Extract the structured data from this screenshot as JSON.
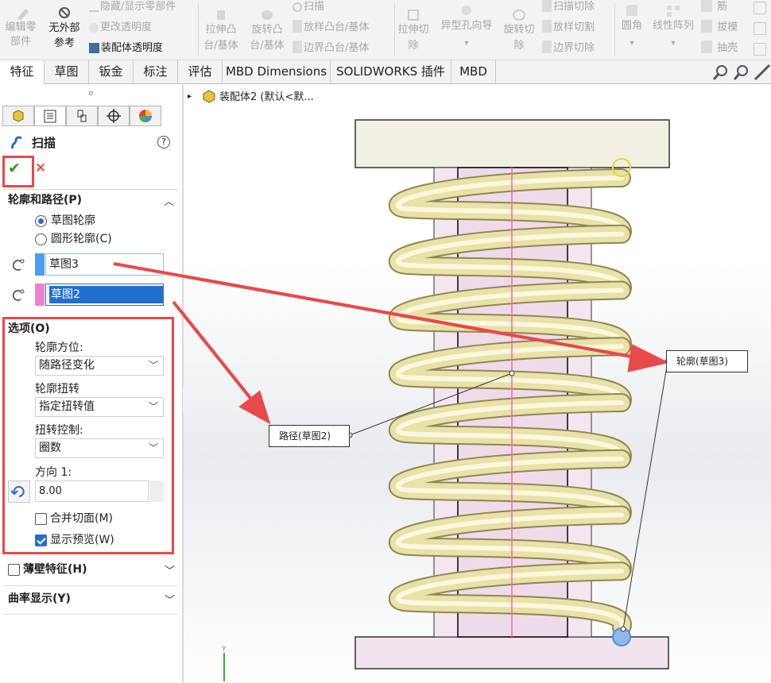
{
  "ribbon": {
    "edit_component": "编辑零部件",
    "no_external": "无外部",
    "reference": "参考",
    "hide_show": "隐藏/显示零部件",
    "change_transparency": "更改透明度",
    "assembly_transparency": "装配体透明度",
    "extrude_boss": "拉伸凸台/基体",
    "revolve_boss": "旋转凸台/基体",
    "sweep": "扫描",
    "loft_boss": "放样凸台/基体",
    "boundary_boss": "边界凸台/基体",
    "extrude_cut": "拉伸切除",
    "hole_wizard": "异型孔向导",
    "revolve_cut": "旋转切除",
    "sweep_cut": "扫描切除",
    "loft_cut": "放样切割",
    "boundary_cut": "边界切除",
    "fillet": "圆角",
    "linear_pattern": "线性阵列",
    "rib": "筋",
    "draft": "拔模",
    "shell": "抽壳"
  },
  "tabs": [
    "特征",
    "草图",
    "钣金",
    "标注",
    "评估",
    "MBD Dimensions",
    "SOLIDWORKS 插件",
    "MBD"
  ],
  "breadcrumb": "装配体2 (默认<默...",
  "panel": {
    "title": "扫描",
    "help": "?",
    "ok": "✔",
    "cancel": "✕",
    "section_profile_path": "轮廓和路径(P)",
    "sketch_profile": "草图轮廓",
    "circular_profile": "圆形轮廓(C)",
    "profile_value": "草图3",
    "path_value": "草图2",
    "options_title": "选项(O)",
    "profile_orientation_label": "轮廓方位:",
    "profile_orientation_value": "随路径变化",
    "profile_twist_label": "轮廓扭转",
    "profile_twist_value": "指定扭转值",
    "twist_control_label": "扭转控制:",
    "twist_control_value": "圈数",
    "direction_label": "方向 1:",
    "direction_value": "8.00",
    "merge_faces": "合并切面(M)",
    "show_preview": "显示预览(W)",
    "thin_feature": "薄壁特征(H)",
    "curvature_display": "曲率显示(Y)"
  },
  "callouts": {
    "path": "路径(草图2)",
    "profile": "轮廓(草图3)"
  },
  "colors": {
    "accent": "#2a6dc8",
    "highlight": "#e8494a",
    "spring": "#e6e0a3",
    "path": "#f06aa8",
    "profile_swatch": "#4d9ef0",
    "path_swatch": "#ee82c8"
  }
}
